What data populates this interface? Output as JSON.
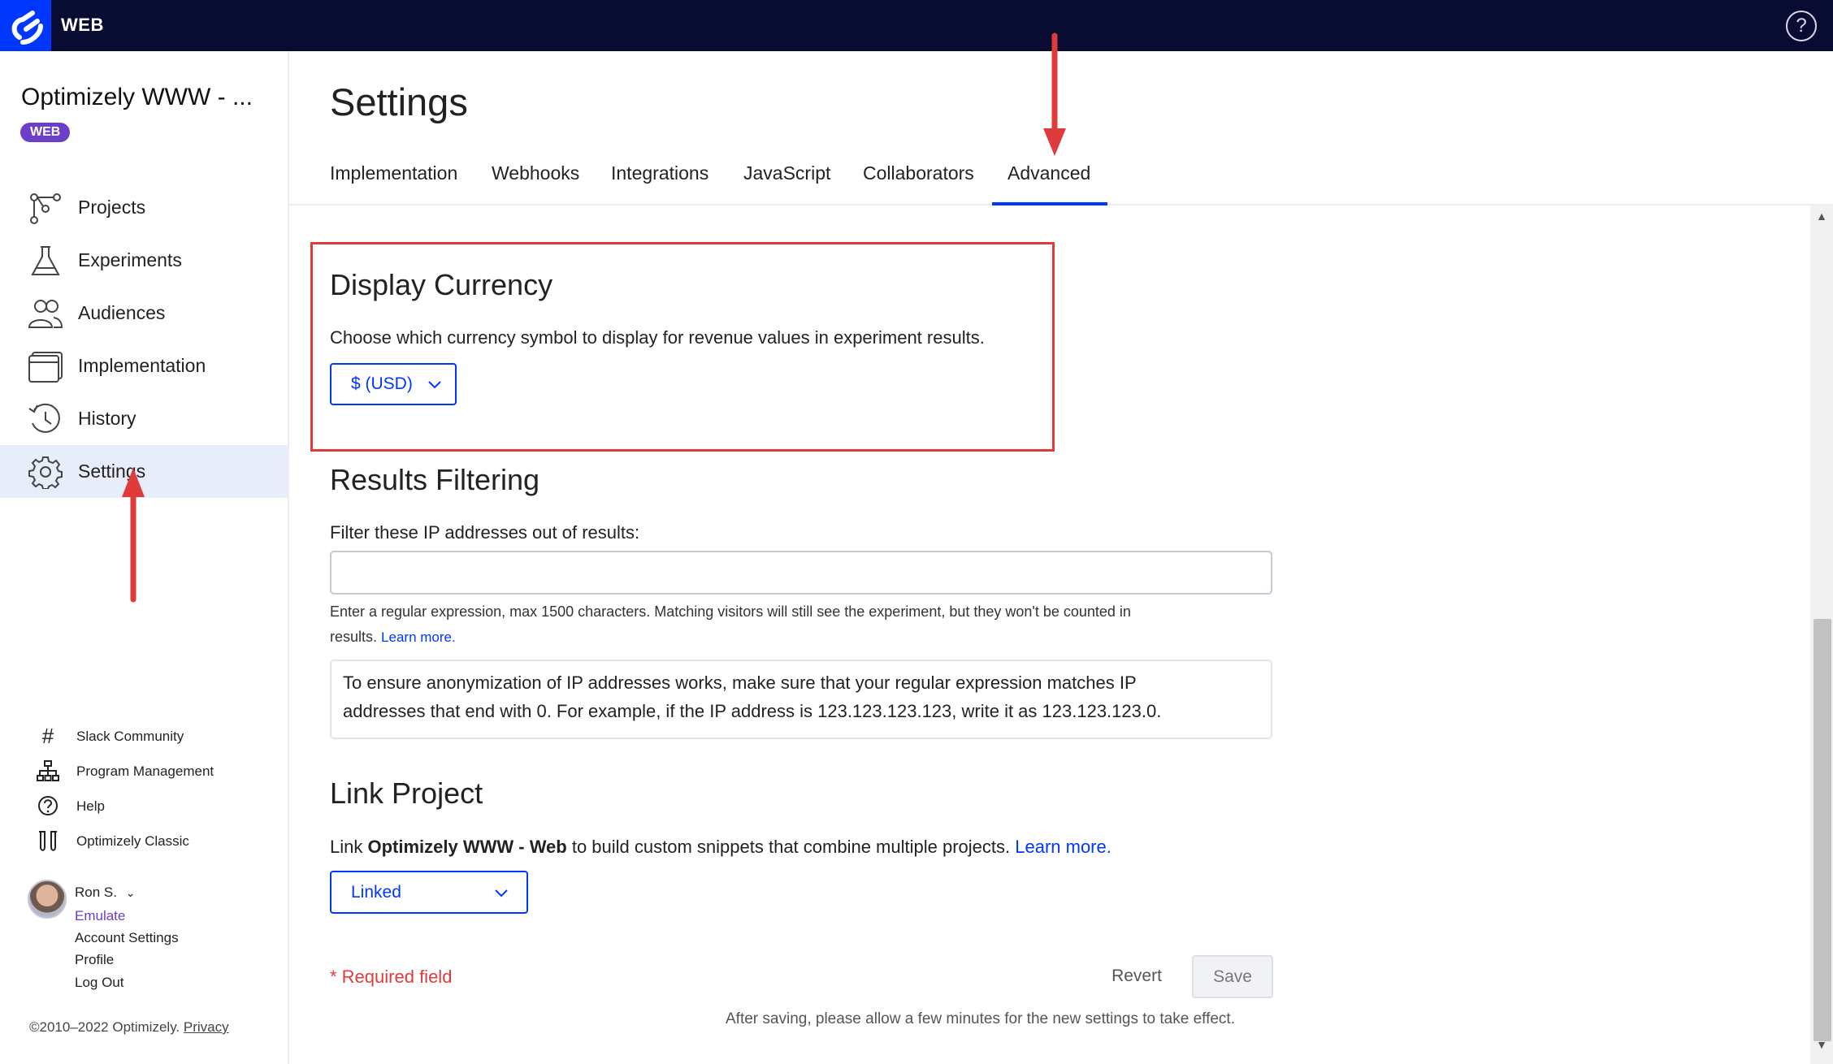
{
  "app": {
    "name": "WEB",
    "help_icon": "help-circle-icon"
  },
  "sidebar": {
    "project_title": "Optimizely WWW - ...",
    "badge": "WEB",
    "nav": [
      {
        "label": "Projects",
        "icon": "projects-icon"
      },
      {
        "label": "Experiments",
        "icon": "flask-icon"
      },
      {
        "label": "Audiences",
        "icon": "audiences-icon"
      },
      {
        "label": "Implementation",
        "icon": "implementation-icon"
      },
      {
        "label": "History",
        "icon": "history-icon"
      },
      {
        "label": "Settings",
        "icon": "gear-icon",
        "active": true
      }
    ],
    "utilities": [
      {
        "label": "Slack Community",
        "icon": "hash-icon"
      },
      {
        "label": "Program Management",
        "icon": "org-chart-icon"
      },
      {
        "label": "Help",
        "icon": "help-icon"
      },
      {
        "label": "Optimizely Classic",
        "icon": "classic-icon"
      }
    ],
    "user": {
      "name": "Ron S.",
      "emulate": "Emulate",
      "account_settings": "Account Settings",
      "profile": "Profile",
      "log_out": "Log Out"
    },
    "footer": {
      "copyright": "©2010–2022 Optimizely.",
      "privacy": "Privacy"
    }
  },
  "main": {
    "title": "Settings",
    "tabs": [
      {
        "label": "Implementation"
      },
      {
        "label": "Webhooks"
      },
      {
        "label": "Integrations"
      },
      {
        "label": "JavaScript"
      },
      {
        "label": "Collaborators"
      },
      {
        "label": "Advanced",
        "active": true
      }
    ],
    "display_currency": {
      "heading": "Display Currency",
      "description": "Choose which currency symbol to display for revenue values in experiment results.",
      "selected": "$ (USD)"
    },
    "results_filtering": {
      "heading": "Results Filtering",
      "label": "Filter these IP addresses out of results:",
      "input_value": "",
      "help_line1": "Enter a regular expression, max 1500 characters. Matching visitors will still see the experiment, but they won't be counted in",
      "help_line2": "results.",
      "learn_more": "Learn more.",
      "note_line1": "To ensure anonymization of IP addresses works, make sure that your regular expression matches IP",
      "note_line2": "addresses that end with 0. For example, if the IP address is 123.123.123.123, write it as 123.123.123.0."
    },
    "link_project": {
      "heading": "Link Project",
      "text_prefix": "Link ",
      "project_name": "Optimizely WWW - Web",
      "text_suffix": " to build custom snippets that combine multiple projects. ",
      "learn_more": "Learn more.",
      "selected": "Linked"
    },
    "footer": {
      "required": "* Required field",
      "revert": "Revert",
      "save": "Save",
      "note": "After saving, please allow a few minutes for the new settings to take effect."
    }
  },
  "colors": {
    "accent": "#0037ff",
    "topbar": "#080c33",
    "badge": "#6b3fc9",
    "annotation": "#e03b3b"
  }
}
